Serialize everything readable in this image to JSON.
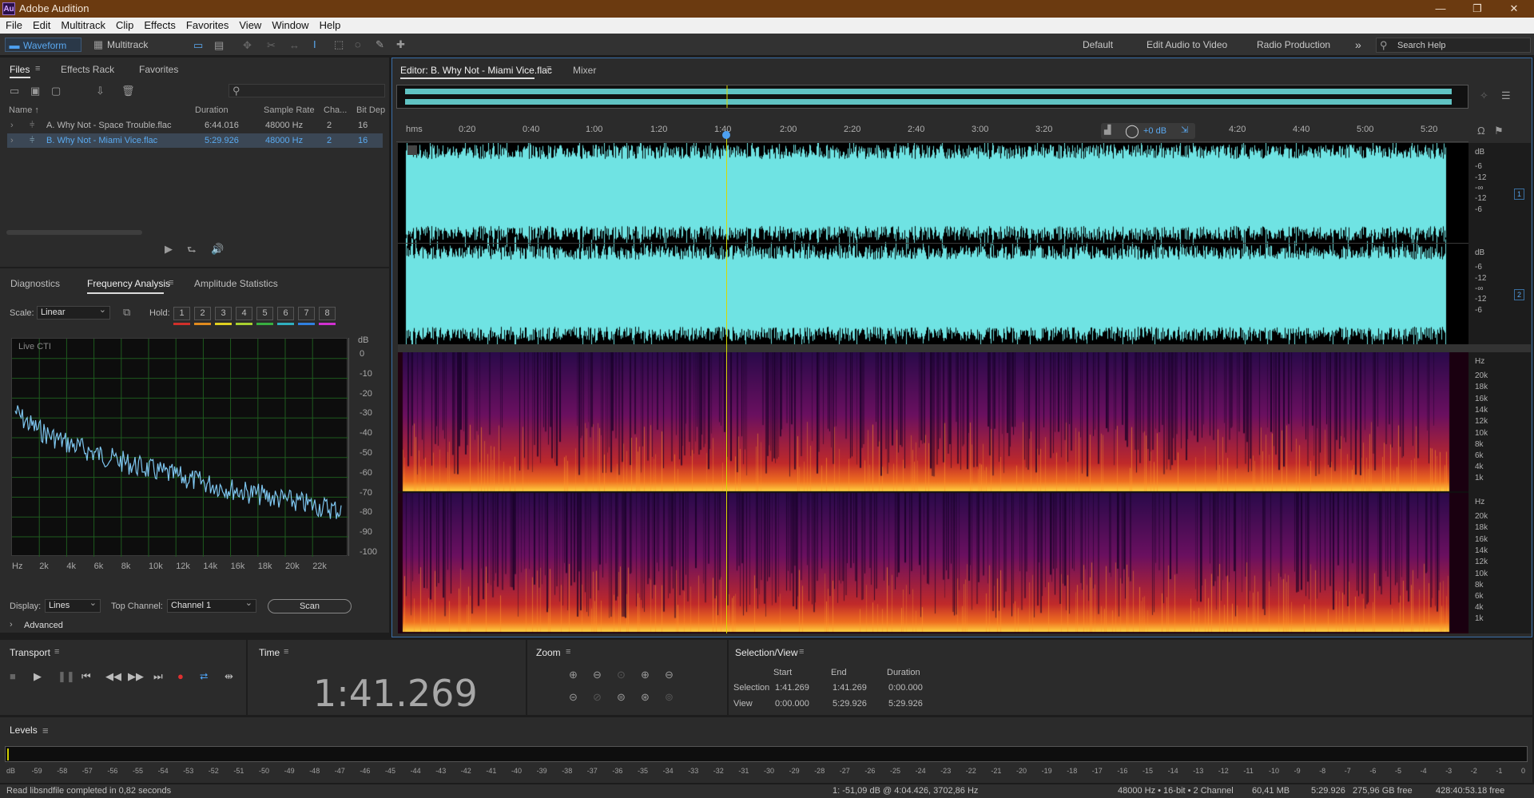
{
  "titlebar": {
    "title": "Adobe Audition",
    "logo": "Au"
  },
  "menu": [
    "File",
    "Edit",
    "Multitrack",
    "Clip",
    "Effects",
    "Favorites",
    "View",
    "Window",
    "Help"
  ],
  "toolbar": {
    "waveform": "Waveform",
    "multitrack": "Multitrack",
    "workspaces": [
      "Default",
      "Edit Audio to Video",
      "Radio Production"
    ],
    "more": "»",
    "search_placeholder": "Search Help"
  },
  "files": {
    "tabs": [
      "Files",
      "Effects Rack",
      "Favorites"
    ],
    "headers": {
      "name": "Name ↑",
      "duration": "Duration",
      "rate": "Sample Rate",
      "ch": "Cha...",
      "bit": "Bit Dep"
    },
    "rows": [
      {
        "name": "A. Why Not - Space Trouble.flac",
        "duration": "6:44.016",
        "rate": "48000 Hz",
        "ch": "2",
        "bit": "16"
      },
      {
        "name": "B. Why Not - Miami Vice.flac",
        "duration": "5:29.926",
        "rate": "48000 Hz",
        "ch": "2",
        "bit": "16"
      }
    ]
  },
  "analysis": {
    "tabs": [
      "Diagnostics",
      "Frequency Analysis",
      "Amplitude Statistics"
    ],
    "scale_label": "Scale:",
    "scale_value": "Linear",
    "hold_label": "Hold:",
    "hold": [
      "1",
      "2",
      "3",
      "4",
      "5",
      "6",
      "7",
      "8"
    ],
    "hold_colors": [
      "#d0302a",
      "#e08a1e",
      "#e0d020",
      "#a8d030",
      "#38b040",
      "#30b0c0",
      "#3080e0",
      "#d030d0"
    ],
    "plot_title": "Live CTI",
    "db_unit": "dB",
    "db_ticks": [
      "0",
      "-10",
      "-20",
      "-30",
      "-40",
      "-50",
      "-60",
      "-70",
      "-80",
      "-90",
      "-100"
    ],
    "hz_ticks": [
      "Hz",
      "2k",
      "4k",
      "6k",
      "8k",
      "10k",
      "12k",
      "14k",
      "16k",
      "18k",
      "20k",
      "22k"
    ],
    "display_label": "Display:",
    "display_value": "Lines",
    "top_channel_label": "Top Channel:",
    "top_channel_value": "Channel 1",
    "scan": "Scan",
    "advanced": "Advanced"
  },
  "editor": {
    "tab": "Editor: B. Why Not - Miami Vice.flac",
    "mixer": "Mixer",
    "ruler": [
      "hms",
      "0:20",
      "0:40",
      "1:00",
      "1:20",
      "1:40",
      "2:00",
      "2:20",
      "2:40",
      "3:00",
      "3:20",
      "4:20",
      "4:40",
      "5:00",
      "5:20"
    ],
    "hud_db": "+0 dB",
    "wave_db": [
      "dB",
      "-6",
      "-12",
      "-∞",
      "-12",
      "-6"
    ],
    "channels": [
      "1",
      "2"
    ],
    "spec_hz": [
      "Hz",
      "20k",
      "18k",
      "16k",
      "14k",
      "12k",
      "10k",
      "8k",
      "6k",
      "4k",
      "1k"
    ],
    "colors": {
      "wave": "#6fe3e3",
      "cti": "#d8d800"
    }
  },
  "transport": {
    "title": "Transport"
  },
  "time": {
    "title": "Time",
    "value": "1:41.269"
  },
  "zoom": {
    "title": "Zoom"
  },
  "selection": {
    "title": "Selection/View",
    "cols": [
      "Start",
      "End",
      "Duration"
    ],
    "selection_label": "Selection",
    "view_label": "View",
    "sel_start": "1:41.269",
    "sel_end": "1:41.269",
    "sel_dur": "0:00.000",
    "view_start": "0:00.000",
    "view_end": "5:29.926",
    "view_dur": "5:29.926"
  },
  "levels": {
    "title": "Levels",
    "ticks": [
      "dB",
      "-59",
      "-58",
      "-57",
      "-56",
      "-55",
      "-54",
      "-53",
      "-52",
      "-51",
      "-50",
      "-49",
      "-48",
      "-47",
      "-46",
      "-45",
      "-44",
      "-43",
      "-42",
      "-41",
      "-40",
      "-39",
      "-38",
      "-37",
      "-36",
      "-35",
      "-34",
      "-33",
      "-32",
      "-31",
      "-30",
      "-29",
      "-28",
      "-27",
      "-26",
      "-25",
      "-24",
      "-23",
      "-22",
      "-21",
      "-20",
      "-19",
      "-18",
      "-17",
      "-16",
      "-15",
      "-14",
      "-13",
      "-12",
      "-11",
      "-10",
      "-9",
      "-8",
      "-7",
      "-6",
      "-5",
      "-4",
      "-3",
      "-2",
      "-1",
      "0"
    ]
  },
  "status": {
    "left": "Read libsndfile completed in 0,82 seconds",
    "cursor": "1: -51,09 dB @ 4:04.426, 3702,86 Hz",
    "format": "48000 Hz • 16-bit • 2 Channel",
    "size": "60,41 MB",
    "duration": "5:29.926",
    "free": "275,96 GB free",
    "free_time": "428:40:53.18 free"
  }
}
